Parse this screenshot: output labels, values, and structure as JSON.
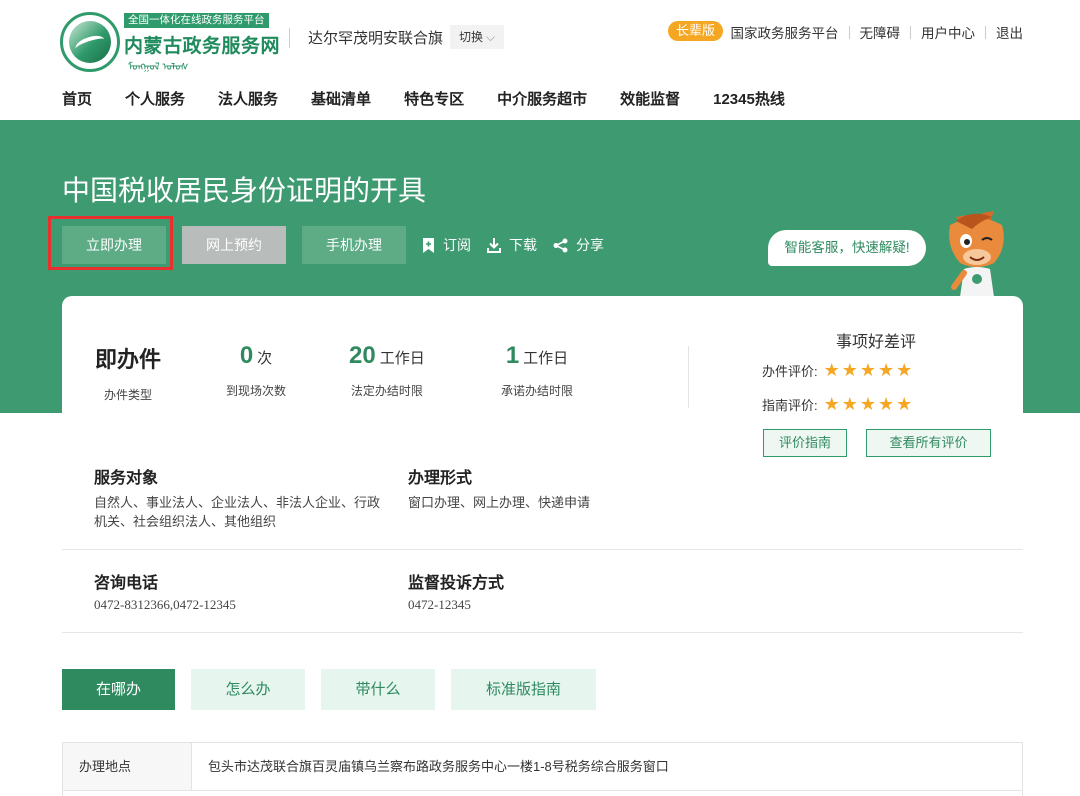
{
  "header": {
    "brand_tag": "全国一体化在线政务服务平台",
    "brand_name": "内蒙古政务服务网",
    "brand_script": "ᠮᠣᠩᠭᠣᠯ ᠤᠯᠤᠰ",
    "region": "达尔罕茂明安联合旗",
    "switch_label": "切换",
    "elder_badge": "长辈版",
    "toplinks": [
      "国家政务服务平台",
      "无障碍",
      "用户中心",
      "退出"
    ]
  },
  "nav": [
    "首页",
    "个人服务",
    "法人服务",
    "基础清单",
    "特色专区",
    "中介服务超市",
    "效能监督",
    "12345热线"
  ],
  "banner": {
    "title": "中国税收居民身份证明的开具",
    "btn_apply": "立即办理",
    "btn_reserve": "网上预约",
    "btn_mobile": "手机办理",
    "subscribe": "订阅",
    "download": "下载",
    "share": "分享",
    "assistant": "智能客服，快速解疑!"
  },
  "stats": {
    "type_value": "即办件",
    "type_label": "办件类型",
    "visits_value": "0",
    "visits_unit": "次",
    "visits_label": "到现场次数",
    "legal_value": "20",
    "legal_unit": "工作日",
    "legal_label": "法定办结时限",
    "promise_value": "1",
    "promise_unit": "工作日",
    "promise_label": "承诺办结时限"
  },
  "rating": {
    "title": "事项好差评",
    "handle_label": "办件评价:",
    "handle_stars": 5,
    "guide_label": "指南评价:",
    "guide_stars": 5,
    "btn_guide": "评价指南",
    "btn_all": "查看所有评价",
    "star_color": "#f5a623"
  },
  "details": {
    "target_head": "服务对象",
    "target_text_1": "自然人、事业法人、企业法人、非法人企业、行政",
    "target_text_2": "机关、社会组织法人、其他组织",
    "form_head": "办理形式",
    "form_text": "窗口办理、网上办理、快递申请",
    "phone_head": "咨询电话",
    "phone_text": "0472-8312366,0472-12345",
    "complaint_head": "监督投诉方式",
    "complaint_text": "0472-12345"
  },
  "tabs": [
    "在哪办",
    "怎么办",
    "带什么",
    "标准版指南"
  ],
  "table": {
    "location_label": "办理地点",
    "location_value": "包头市达茂联合旗百灵庙镇乌兰察布路政务服务中心一楼1-8号税务综合服务窗口"
  },
  "colors": {
    "brand_green": "#2f8a60",
    "banner_green": "#3e9a71",
    "highlight_red": "#e8302e",
    "elder_orange": "#f5a623"
  }
}
